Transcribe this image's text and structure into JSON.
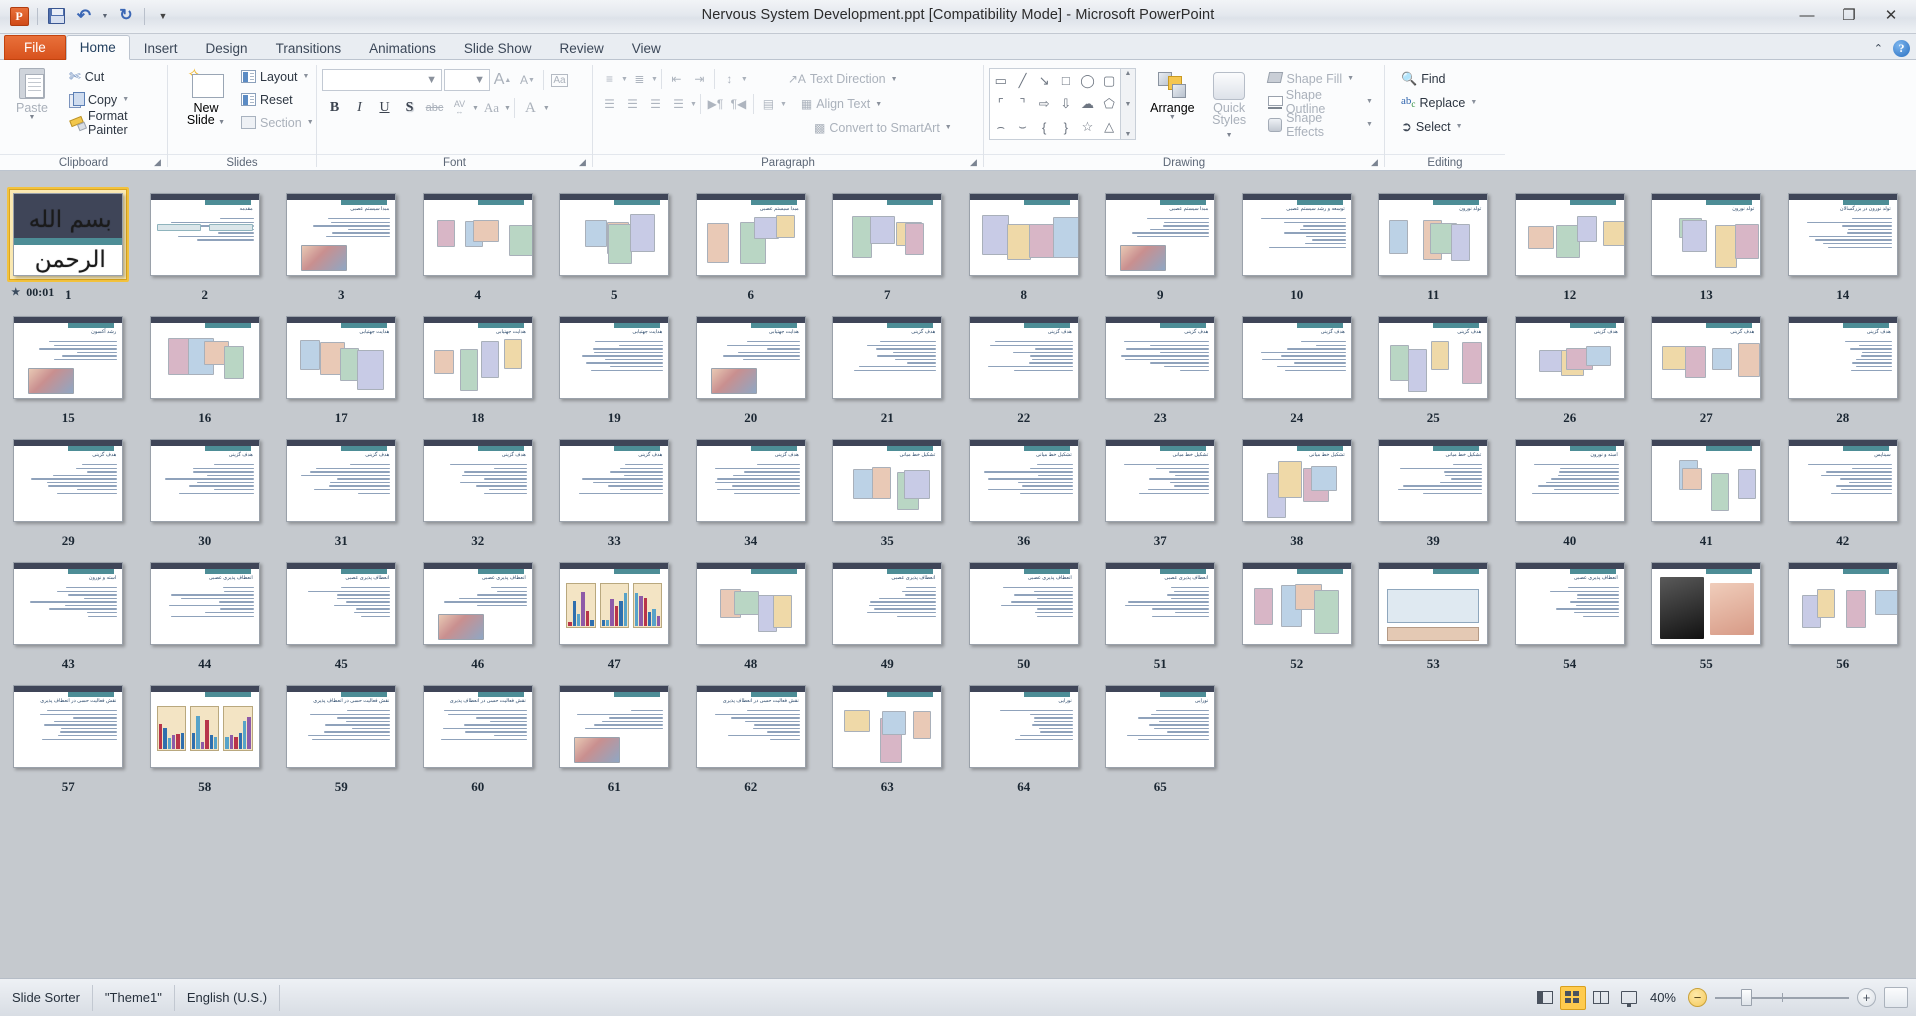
{
  "window": {
    "title": "Nervous System Development.ppt [Compatibility Mode]  -  Microsoft PowerPoint",
    "minimize_label": "—",
    "restore_label": "❐",
    "close_label": "✕",
    "collapse_ribbon_label": "⌃",
    "help_label": "?"
  },
  "quick_access": [
    {
      "name": "office-button",
      "label": "P"
    },
    {
      "name": "save-button",
      "label": ""
    },
    {
      "name": "undo-button",
      "label": "↶"
    },
    {
      "name": "redo-button",
      "label": "↻"
    },
    {
      "name": "customize-qat-button",
      "label": "▼"
    }
  ],
  "tabs": [
    {
      "label": "File",
      "active": false,
      "file": true
    },
    {
      "label": "Home",
      "active": true
    },
    {
      "label": "Insert",
      "active": false
    },
    {
      "label": "Design",
      "active": false
    },
    {
      "label": "Transitions",
      "active": false
    },
    {
      "label": "Animations",
      "active": false
    },
    {
      "label": "Slide Show",
      "active": false
    },
    {
      "label": "Review",
      "active": false
    },
    {
      "label": "View",
      "active": false
    }
  ],
  "ribbon": {
    "groups": [
      {
        "label": "Clipboard",
        "launcher": true
      },
      {
        "label": "Slides",
        "launcher": false
      },
      {
        "label": "Font",
        "launcher": true
      },
      {
        "label": "Paragraph",
        "launcher": true
      },
      {
        "label": "Drawing",
        "launcher": true
      },
      {
        "label": "Editing",
        "launcher": false
      }
    ],
    "clipboard": {
      "paste": "Paste",
      "cut": "Cut",
      "copy": "Copy",
      "format_painter": "Format Painter"
    },
    "slides": {
      "new_slide": "New",
      "new_slide_2": "Slide",
      "layout": "Layout",
      "reset": "Reset",
      "section": "Section"
    },
    "font": {
      "font_name_value": "",
      "font_name_placeholder": "",
      "font_size_value": "",
      "font_size_placeholder": "",
      "grow": "A",
      "shrink": "A",
      "clear_formatting": "Aa",
      "bold": "B",
      "italic": "I",
      "underline": "U",
      "shadow": "S",
      "strikethrough": "abc",
      "spacing": "AV",
      "change_case": "Aa",
      "font_color": "A"
    },
    "paragraph": {
      "text_direction": "Text Direction",
      "align_text": "Align Text",
      "convert_smartart": "Convert to SmartArt"
    },
    "drawing": {
      "arrange": "Arrange",
      "quick_styles": "Quick",
      "quick_styles_2": "Styles",
      "shape_fill": "Shape Fill",
      "shape_outline": "Shape Outline",
      "shape_effects": "Shape Effects",
      "shapes": [
        "▭",
        "╲",
        "↘",
        "□",
        "◯",
        "▢",
        "⌐",
        "┓",
        "⇒",
        "⇓",
        "☁",
        "⌒",
        "⌓",
        "{",
        "}",
        "☆",
        "△",
        "〜"
      ]
    },
    "editing": {
      "find": "Find",
      "replace": "Replace",
      "select": "Select"
    }
  },
  "statusbar": {
    "view_name": "Slide Sorter",
    "theme": "\"Theme1\"",
    "language": "English (U.S.)",
    "zoom_percent": "40%",
    "zoom_out_label": "−",
    "zoom_in_label": "+",
    "views": [
      {
        "name": "normal",
        "label": "Normal",
        "active": false
      },
      {
        "name": "slide-sorter",
        "label": "Slide Sorter",
        "active": true
      },
      {
        "name": "reading",
        "label": "Reading View",
        "active": false
      },
      {
        "name": "slideshow",
        "label": "Slide Show",
        "active": false
      }
    ]
  },
  "sorter": {
    "selected_slide": 1,
    "slide_count": 65,
    "columns": 14,
    "timing_badge": "00:01",
    "title_slide_text_1": "بسم الله الرحمن الرحيم",
    "slides": [
      {
        "n": 1,
        "kind": "title",
        "title": ""
      },
      {
        "n": 2,
        "kind": "two-col",
        "title": "مقدمه"
      },
      {
        "n": 3,
        "kind": "text-pic",
        "title": "مبدا سیستم عصبی"
      },
      {
        "n": 4,
        "kind": "picture",
        "title": ""
      },
      {
        "n": 5,
        "kind": "picture",
        "title": ""
      },
      {
        "n": 6,
        "kind": "picture",
        "title": "مبدا سیستم عصبی"
      },
      {
        "n": 7,
        "kind": "picture",
        "title": ""
      },
      {
        "n": 8,
        "kind": "picture",
        "title": ""
      },
      {
        "n": 9,
        "kind": "text-pic",
        "title": "مبدا سیستم عصبی"
      },
      {
        "n": 10,
        "kind": "text",
        "title": "توسعه و رشد سیستم عصبی"
      },
      {
        "n": 11,
        "kind": "picture",
        "title": "تولد نورون"
      },
      {
        "n": 12,
        "kind": "picture",
        "title": ""
      },
      {
        "n": 13,
        "kind": "picture",
        "title": "تولد نورون"
      },
      {
        "n": 14,
        "kind": "text",
        "title": "تولد نورون در بزرگسالان"
      },
      {
        "n": 15,
        "kind": "text-pic",
        "title": "رشد آکسون"
      },
      {
        "n": 16,
        "kind": "picture",
        "title": ""
      },
      {
        "n": 17,
        "kind": "picture",
        "title": "هدایت جهتیابی"
      },
      {
        "n": 18,
        "kind": "picture",
        "title": "هدایت جهتیابی"
      },
      {
        "n": 19,
        "kind": "text",
        "title": "هدایت جهتیابی"
      },
      {
        "n": 20,
        "kind": "text-pic",
        "title": "هدایت جهتیابی"
      },
      {
        "n": 21,
        "kind": "text",
        "title": "هدف گزینی"
      },
      {
        "n": 22,
        "kind": "text",
        "title": "هدف گزینی"
      },
      {
        "n": 23,
        "kind": "text",
        "title": "هدف گزینی"
      },
      {
        "n": 24,
        "kind": "text",
        "title": "هدف گزینی"
      },
      {
        "n": 25,
        "kind": "picture",
        "title": "هدف گزینی"
      },
      {
        "n": 26,
        "kind": "picture",
        "title": "هدف گزینی"
      },
      {
        "n": 27,
        "kind": "picture",
        "title": "هدف گزینی"
      },
      {
        "n": 28,
        "kind": "text",
        "title": "هدف گزینی"
      },
      {
        "n": 29,
        "kind": "text",
        "title": "هدف گزینی"
      },
      {
        "n": 30,
        "kind": "text",
        "title": "هدف گزینی"
      },
      {
        "n": 31,
        "kind": "text",
        "title": "هدف گزینی"
      },
      {
        "n": 32,
        "kind": "text",
        "title": "هدف گزینی"
      },
      {
        "n": 33,
        "kind": "text",
        "title": "هدف گزینی"
      },
      {
        "n": 34,
        "kind": "text",
        "title": "هدف گزینی"
      },
      {
        "n": 35,
        "kind": "picture",
        "title": "تشکیل خط میانی"
      },
      {
        "n": 36,
        "kind": "text",
        "title": "تشکیل خط میانی"
      },
      {
        "n": 37,
        "kind": "text",
        "title": "تشکیل خط میانی"
      },
      {
        "n": 38,
        "kind": "picture",
        "title": "تشکیل خط میانی"
      },
      {
        "n": 39,
        "kind": "text",
        "title": "تشکیل خط میانی"
      },
      {
        "n": 40,
        "kind": "text",
        "title": "استه و نورون"
      },
      {
        "n": 41,
        "kind": "picture",
        "title": ""
      },
      {
        "n": 42,
        "kind": "text",
        "title": "سیناپس"
      },
      {
        "n": 43,
        "kind": "text",
        "title": "استه و نورون"
      },
      {
        "n": 44,
        "kind": "text",
        "title": "انعطاف پذیری عصبی"
      },
      {
        "n": 45,
        "kind": "text",
        "title": "انعطاف پذیری عصبی"
      },
      {
        "n": 46,
        "kind": "text-pic",
        "title": "انعطاف پذیری عصبی"
      },
      {
        "n": 47,
        "kind": "chart",
        "title": ""
      },
      {
        "n": 48,
        "kind": "picture",
        "title": ""
      },
      {
        "n": 49,
        "kind": "text",
        "title": "انعطاف پذیری عصبی"
      },
      {
        "n": 50,
        "kind": "text",
        "title": "انعطاف پذیری عصبی"
      },
      {
        "n": 51,
        "kind": "text",
        "title": "انعطاف پذیری عصبی"
      },
      {
        "n": 52,
        "kind": "picture",
        "title": ""
      },
      {
        "n": 53,
        "kind": "table",
        "title": ""
      },
      {
        "n": 54,
        "kind": "text",
        "title": "انعطاف پذیری عصبی"
      },
      {
        "n": 55,
        "kind": "photo",
        "title": ""
      },
      {
        "n": 56,
        "kind": "picture",
        "title": ""
      },
      {
        "n": 57,
        "kind": "text",
        "title": "نقش فعالیت حسی در انعطاف پذیری"
      },
      {
        "n": 58,
        "kind": "chart",
        "title": ""
      },
      {
        "n": 59,
        "kind": "text",
        "title": "نقش فعالیت حسی در انعطاف پذیری"
      },
      {
        "n": 60,
        "kind": "text",
        "title": "نقش فعالیت حسی در انعطاف پذیری"
      },
      {
        "n": 61,
        "kind": "text-pic",
        "title": ""
      },
      {
        "n": 62,
        "kind": "text",
        "title": "نقش فعالیت حسی در انعطاف پذیری"
      },
      {
        "n": 63,
        "kind": "picture",
        "title": ""
      },
      {
        "n": 64,
        "kind": "text",
        "title": "نورایی"
      },
      {
        "n": 65,
        "kind": "text",
        "title": "نورایی"
      }
    ]
  },
  "colors": {
    "accent_orange": "#d8521d",
    "selection_gold": "#f3c23d",
    "slide_header_dark": "#3f4558",
    "slide_header_teal": "#4d8d96",
    "workspace_gray": "#c5c9ce"
  }
}
